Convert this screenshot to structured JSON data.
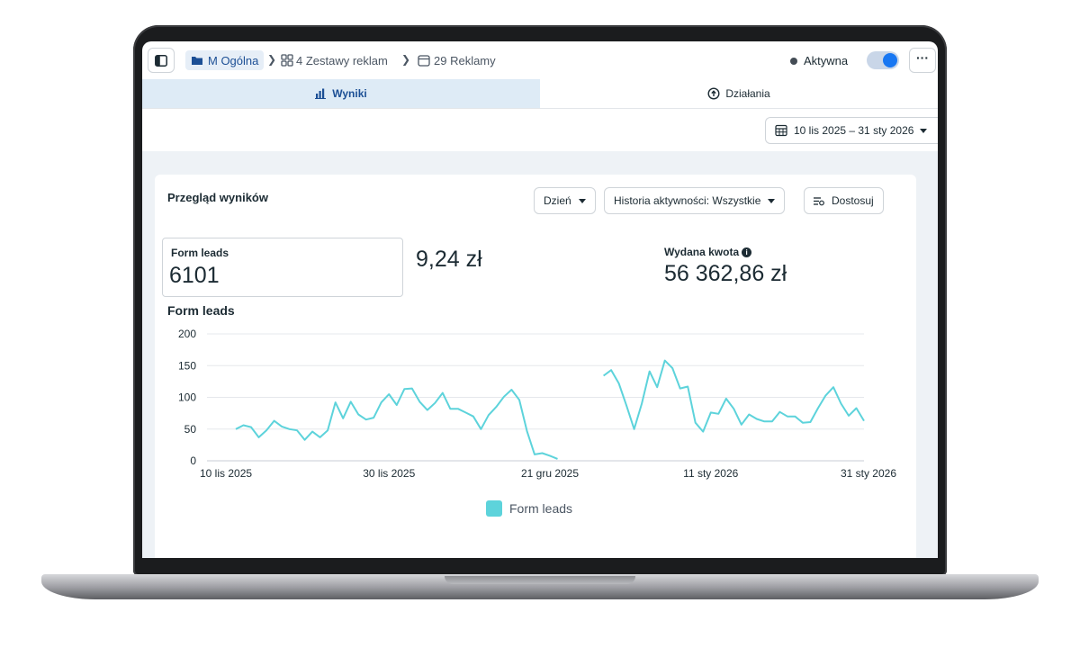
{
  "topbar": {
    "breadcrumb": [
      {
        "label": "M Ogólna",
        "icon": "folder-icon"
      },
      {
        "label": "4 Zestawy reklam",
        "icon": "grid-icon"
      },
      {
        "label": "29 Reklamy",
        "icon": "ad-icon"
      }
    ],
    "status": "Aktywna",
    "more_label": "···"
  },
  "tabs": [
    {
      "label": "Wyniki",
      "icon": "bar-chart-icon",
      "active": true
    },
    {
      "label": "Działania",
      "icon": "activity-icon",
      "active": false
    }
  ],
  "date_range": "10 lis 2025 – 31 sty 2026",
  "overview": {
    "title": "Przegląd wyników",
    "controls": {
      "granularity": "Dzień",
      "history": "Historia aktywności: Wszystkie",
      "customize": "Dostosuj"
    },
    "metrics": {
      "form_leads_label": "Form leads",
      "form_leads_value": "6101",
      "cost_per_result": "9,24 zł",
      "spent_label": "Wydana kwota",
      "spent_value": "56 362,86 zł"
    },
    "chart_title": "Form leads"
  },
  "colors": {
    "accent": "#1877f2",
    "series": "#5dd3db",
    "tab_active_bg": "#deebf6"
  },
  "chart_data": {
    "type": "line",
    "title": "Form leads",
    "ylim": [
      0,
      200
    ],
    "yticks": [
      "0",
      "50",
      "100",
      "150",
      "200"
    ],
    "xtick_labels": [
      {
        "index": 0,
        "label": "10 lis 2025"
      },
      {
        "index": 20,
        "label": "30 lis 2025"
      },
      {
        "index": 41,
        "label": "21 gru 2025"
      },
      {
        "index": 62,
        "label": "11 sty 2026"
      },
      {
        "index": 82,
        "label": "31 sty 2026"
      }
    ],
    "grid": true,
    "legend_position": "bottom",
    "series": [
      {
        "name": "Form leads",
        "values": [
          50,
          56,
          53,
          37,
          48,
          63,
          54,
          50,
          48,
          33,
          46,
          37,
          48,
          92,
          67,
          93,
          73,
          65,
          68,
          92,
          105,
          88,
          113,
          114,
          93,
          80,
          91,
          107,
          82,
          82,
          76,
          70,
          50,
          72,
          85,
          101,
          112,
          96,
          47,
          10,
          12,
          8,
          3,
          null,
          null,
          null,
          null,
          null,
          null,
          null,
          null,
          null,
          null,
          null,
          null,
          null,
          null,
          null,
          null,
          null,
          null,
          null,
          null,
          null,
          null,
          null,
          null,
          null,
          null,
          null,
          null,
          null,
          null,
          null,
          null,
          null,
          null,
          null,
          null,
          null,
          null,
          null,
          null
        ],
        "values_part2_start_index": 48,
        "values_part2": [
          134,
          143,
          122,
          87,
          50,
          90,
          141,
          116,
          158,
          146,
          114,
          117,
          60,
          46,
          76,
          74,
          98,
          82,
          57,
          73,
          66,
          62,
          62,
          77,
          70,
          70,
          60,
          61,
          83,
          103,
          116,
          90,
          71,
          83,
          63
        ]
      }
    ]
  }
}
